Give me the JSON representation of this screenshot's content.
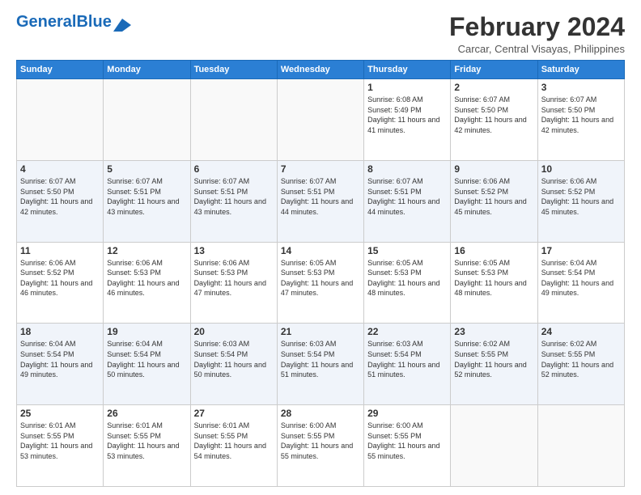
{
  "header": {
    "logo_general": "General",
    "logo_blue": "Blue",
    "month_title": "February 2024",
    "location": "Carcar, Central Visayas, Philippines"
  },
  "weekdays": [
    "Sunday",
    "Monday",
    "Tuesday",
    "Wednesday",
    "Thursday",
    "Friday",
    "Saturday"
  ],
  "weeks": [
    [
      {
        "day": "",
        "sunrise": "",
        "sunset": "",
        "daylight": "",
        "empty": true
      },
      {
        "day": "",
        "sunrise": "",
        "sunset": "",
        "daylight": "",
        "empty": true
      },
      {
        "day": "",
        "sunrise": "",
        "sunset": "",
        "daylight": "",
        "empty": true
      },
      {
        "day": "",
        "sunrise": "",
        "sunset": "",
        "daylight": "",
        "empty": true
      },
      {
        "day": "1",
        "sunrise": "Sunrise: 6:08 AM",
        "sunset": "Sunset: 5:49 PM",
        "daylight": "Daylight: 11 hours and 41 minutes.",
        "empty": false
      },
      {
        "day": "2",
        "sunrise": "Sunrise: 6:07 AM",
        "sunset": "Sunset: 5:50 PM",
        "daylight": "Daylight: 11 hours and 42 minutes.",
        "empty": false
      },
      {
        "day": "3",
        "sunrise": "Sunrise: 6:07 AM",
        "sunset": "Sunset: 5:50 PM",
        "daylight": "Daylight: 11 hours and 42 minutes.",
        "empty": false
      }
    ],
    [
      {
        "day": "4",
        "sunrise": "Sunrise: 6:07 AM",
        "sunset": "Sunset: 5:50 PM",
        "daylight": "Daylight: 11 hours and 42 minutes.",
        "empty": false
      },
      {
        "day": "5",
        "sunrise": "Sunrise: 6:07 AM",
        "sunset": "Sunset: 5:51 PM",
        "daylight": "Daylight: 11 hours and 43 minutes.",
        "empty": false
      },
      {
        "day": "6",
        "sunrise": "Sunrise: 6:07 AM",
        "sunset": "Sunset: 5:51 PM",
        "daylight": "Daylight: 11 hours and 43 minutes.",
        "empty": false
      },
      {
        "day": "7",
        "sunrise": "Sunrise: 6:07 AM",
        "sunset": "Sunset: 5:51 PM",
        "daylight": "Daylight: 11 hours and 44 minutes.",
        "empty": false
      },
      {
        "day": "8",
        "sunrise": "Sunrise: 6:07 AM",
        "sunset": "Sunset: 5:51 PM",
        "daylight": "Daylight: 11 hours and 44 minutes.",
        "empty": false
      },
      {
        "day": "9",
        "sunrise": "Sunrise: 6:06 AM",
        "sunset": "Sunset: 5:52 PM",
        "daylight": "Daylight: 11 hours and 45 minutes.",
        "empty": false
      },
      {
        "day": "10",
        "sunrise": "Sunrise: 6:06 AM",
        "sunset": "Sunset: 5:52 PM",
        "daylight": "Daylight: 11 hours and 45 minutes.",
        "empty": false
      }
    ],
    [
      {
        "day": "11",
        "sunrise": "Sunrise: 6:06 AM",
        "sunset": "Sunset: 5:52 PM",
        "daylight": "Daylight: 11 hours and 46 minutes.",
        "empty": false
      },
      {
        "day": "12",
        "sunrise": "Sunrise: 6:06 AM",
        "sunset": "Sunset: 5:53 PM",
        "daylight": "Daylight: 11 hours and 46 minutes.",
        "empty": false
      },
      {
        "day": "13",
        "sunrise": "Sunrise: 6:06 AM",
        "sunset": "Sunset: 5:53 PM",
        "daylight": "Daylight: 11 hours and 47 minutes.",
        "empty": false
      },
      {
        "day": "14",
        "sunrise": "Sunrise: 6:05 AM",
        "sunset": "Sunset: 5:53 PM",
        "daylight": "Daylight: 11 hours and 47 minutes.",
        "empty": false
      },
      {
        "day": "15",
        "sunrise": "Sunrise: 6:05 AM",
        "sunset": "Sunset: 5:53 PM",
        "daylight": "Daylight: 11 hours and 48 minutes.",
        "empty": false
      },
      {
        "day": "16",
        "sunrise": "Sunrise: 6:05 AM",
        "sunset": "Sunset: 5:53 PM",
        "daylight": "Daylight: 11 hours and 48 minutes.",
        "empty": false
      },
      {
        "day": "17",
        "sunrise": "Sunrise: 6:04 AM",
        "sunset": "Sunset: 5:54 PM",
        "daylight": "Daylight: 11 hours and 49 minutes.",
        "empty": false
      }
    ],
    [
      {
        "day": "18",
        "sunrise": "Sunrise: 6:04 AM",
        "sunset": "Sunset: 5:54 PM",
        "daylight": "Daylight: 11 hours and 49 minutes.",
        "empty": false
      },
      {
        "day": "19",
        "sunrise": "Sunrise: 6:04 AM",
        "sunset": "Sunset: 5:54 PM",
        "daylight": "Daylight: 11 hours and 50 minutes.",
        "empty": false
      },
      {
        "day": "20",
        "sunrise": "Sunrise: 6:03 AM",
        "sunset": "Sunset: 5:54 PM",
        "daylight": "Daylight: 11 hours and 50 minutes.",
        "empty": false
      },
      {
        "day": "21",
        "sunrise": "Sunrise: 6:03 AM",
        "sunset": "Sunset: 5:54 PM",
        "daylight": "Daylight: 11 hours and 51 minutes.",
        "empty": false
      },
      {
        "day": "22",
        "sunrise": "Sunrise: 6:03 AM",
        "sunset": "Sunset: 5:54 PM",
        "daylight": "Daylight: 11 hours and 51 minutes.",
        "empty": false
      },
      {
        "day": "23",
        "sunrise": "Sunrise: 6:02 AM",
        "sunset": "Sunset: 5:55 PM",
        "daylight": "Daylight: 11 hours and 52 minutes.",
        "empty": false
      },
      {
        "day": "24",
        "sunrise": "Sunrise: 6:02 AM",
        "sunset": "Sunset: 5:55 PM",
        "daylight": "Daylight: 11 hours and 52 minutes.",
        "empty": false
      }
    ],
    [
      {
        "day": "25",
        "sunrise": "Sunrise: 6:01 AM",
        "sunset": "Sunset: 5:55 PM",
        "daylight": "Daylight: 11 hours and 53 minutes.",
        "empty": false
      },
      {
        "day": "26",
        "sunrise": "Sunrise: 6:01 AM",
        "sunset": "Sunset: 5:55 PM",
        "daylight": "Daylight: 11 hours and 53 minutes.",
        "empty": false
      },
      {
        "day": "27",
        "sunrise": "Sunrise: 6:01 AM",
        "sunset": "Sunset: 5:55 PM",
        "daylight": "Daylight: 11 hours and 54 minutes.",
        "empty": false
      },
      {
        "day": "28",
        "sunrise": "Sunrise: 6:00 AM",
        "sunset": "Sunset: 5:55 PM",
        "daylight": "Daylight: 11 hours and 55 minutes.",
        "empty": false
      },
      {
        "day": "29",
        "sunrise": "Sunrise: 6:00 AM",
        "sunset": "Sunset: 5:55 PM",
        "daylight": "Daylight: 11 hours and 55 minutes.",
        "empty": false
      },
      {
        "day": "",
        "sunrise": "",
        "sunset": "",
        "daylight": "",
        "empty": true
      },
      {
        "day": "",
        "sunrise": "",
        "sunset": "",
        "daylight": "",
        "empty": true
      }
    ]
  ]
}
